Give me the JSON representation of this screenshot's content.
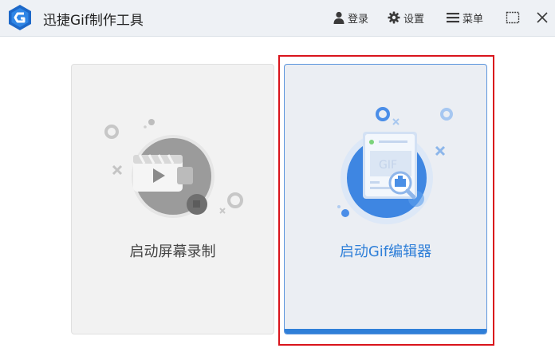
{
  "app": {
    "title": "迅捷Gif制作工具"
  },
  "titlebar": {
    "login_label": "登录",
    "settings_label": "设置",
    "menu_label": "菜单",
    "login_icon": "user-icon",
    "settings_icon": "gear-icon",
    "menu_icon": "hamburger-icon"
  },
  "cards": [
    {
      "label": "启动屏幕录制",
      "icon": "video-camera-icon"
    },
    {
      "label": "启动Gif编辑器",
      "icon": "gif-editor-icon"
    }
  ],
  "colors": {
    "accent": "#2f7fd8",
    "highlight": "#d9141c",
    "titlebar_bg": "#eef1f5"
  }
}
